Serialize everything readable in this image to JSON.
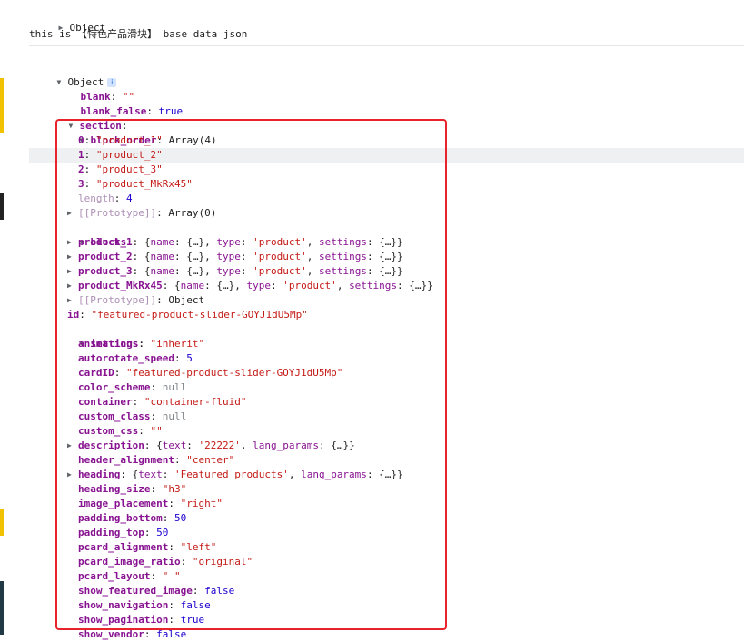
{
  "console": {
    "top_object_label": "Object",
    "log_text": "this is 【特色产品滑块】 base data json",
    "object_label": "Object",
    "info_icon_glyph": "i",
    "props": {
      "blank_key": "blank",
      "blank_val": "\"\"",
      "blank_false_key": "blank_false",
      "blank_false_val": "true",
      "section_key": "section"
    },
    "block_order": {
      "key": "block_order",
      "summary": "Array(4)",
      "items": [
        {
          "idx": "0",
          "val": "\"product_1\""
        },
        {
          "idx": "1",
          "val": "\"product_2\""
        },
        {
          "idx": "2",
          "val": "\"product_3\""
        },
        {
          "idx": "3",
          "val": "\"product_MkRx45\""
        }
      ],
      "length_key": "length",
      "length_val": "4",
      "proto_key": "[[Prototype]]",
      "proto_val": "Array(0)"
    },
    "blocks": {
      "key": "blocks",
      "items": [
        {
          "key": "product_1",
          "name": "name",
          "type_key": "type",
          "type_val": "'product'",
          "settings": "settings"
        },
        {
          "key": "product_2",
          "name": "name",
          "type_key": "type",
          "type_val": "'product'",
          "settings": "settings"
        },
        {
          "key": "product_3",
          "name": "name",
          "type_key": "type",
          "type_val": "'product'",
          "settings": "settings"
        },
        {
          "key": "product_MkRx45",
          "name": "name",
          "type_key": "type",
          "type_val": "'product'",
          "settings": "settings"
        }
      ],
      "proto_key": "[[Prototype]]",
      "proto_val": "Object"
    },
    "id": {
      "key": "id",
      "val": "\"featured-product-slider-GOYJ1dU5Mp\""
    },
    "settings": {
      "key": "settings",
      "rows": [
        {
          "key": "animations",
          "val": "\"inherit\"",
          "kind": "s"
        },
        {
          "key": "autorotate_speed",
          "val": "5",
          "kind": "n"
        },
        {
          "key": "cardID",
          "val": "\"featured-product-slider-GOYJ1dU5Mp\"",
          "kind": "s"
        },
        {
          "key": "color_scheme",
          "val": "null",
          "kind": "nu"
        },
        {
          "key": "container",
          "val": "\"container-fluid\"",
          "kind": "s"
        },
        {
          "key": "custom_class",
          "val": "null",
          "kind": "nu"
        },
        {
          "key": "custom_css",
          "val": "\"\"",
          "kind": "s"
        },
        {
          "key": "description",
          "val": "{text: '22222', lang_params: {…}}",
          "kind": "obj"
        },
        {
          "key": "header_alignment",
          "val": "\"center\"",
          "kind": "s"
        },
        {
          "key": "heading",
          "val": "{text: 'Featured products', lang_params: {…}}",
          "kind": "obj"
        },
        {
          "key": "heading_size",
          "val": "\"h3\"",
          "kind": "s"
        },
        {
          "key": "image_placement",
          "val": "\"right\"",
          "kind": "s"
        },
        {
          "key": "padding_bottom",
          "val": "50",
          "kind": "n"
        },
        {
          "key": "padding_top",
          "val": "50",
          "kind": "n"
        },
        {
          "key": "pcard_alignment",
          "val": "\"left\"",
          "kind": "s"
        },
        {
          "key": "pcard_image_ratio",
          "val": "\"original\"",
          "kind": "s"
        },
        {
          "key": "pcard_layout",
          "val": "\" \"",
          "kind": "s"
        },
        {
          "key": "show_featured_image",
          "val": "false",
          "kind": "b"
        },
        {
          "key": "show_navigation",
          "val": "false",
          "kind": "b"
        },
        {
          "key": "show_pagination",
          "val": "true",
          "kind": "b"
        },
        {
          "key": "show_vendor",
          "val": "false",
          "kind": "b"
        }
      ]
    },
    "colors": {
      "highlight_box": "#e8232b",
      "key": "#881391",
      "string": "#c41a16",
      "number": "#1c00cf"
    }
  }
}
